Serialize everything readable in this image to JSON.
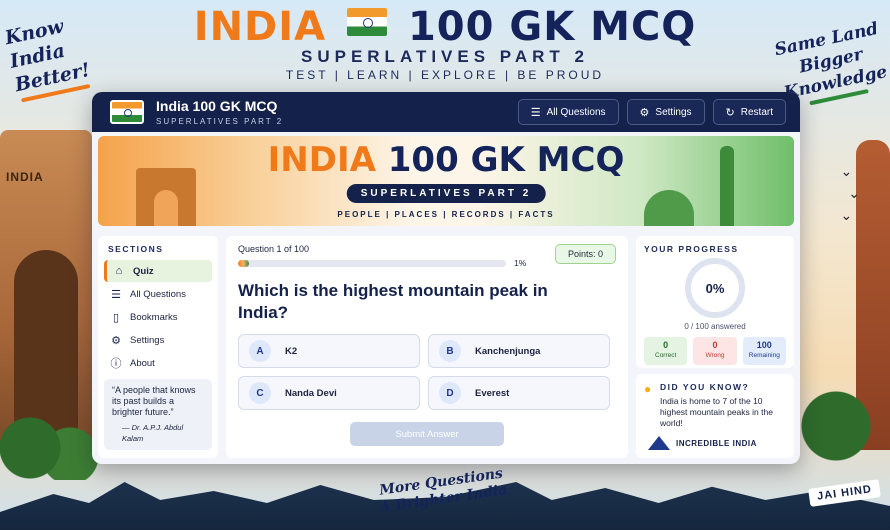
{
  "poster": {
    "title_india": "INDIA",
    "title_rest": "100 GK MCQ",
    "subtitle": "SUPERLATIVES PART 2",
    "tagline": "TEST | LEARN | EXPLORE | BE PROUD",
    "hand_left": [
      "Know",
      "India",
      "Better!"
    ],
    "hand_right": [
      "Same Land",
      "Bigger",
      "Knowledge"
    ],
    "bottom_left": [
      "More Questions",
      "A Brighter India"
    ],
    "jai_hind": "JAI HIND",
    "gate_label": "INDIA"
  },
  "app_bar": {
    "title": "India 100 GK MCQ",
    "subtitle": "SUPERLATIVES PART 2",
    "buttons": [
      {
        "label": "All Questions",
        "icon": "list-icon"
      },
      {
        "label": "Settings",
        "icon": "gear-icon"
      },
      {
        "label": "Restart",
        "icon": "restart-icon"
      }
    ]
  },
  "banner": {
    "title_india": "INDIA",
    "title_rest": "100 GK MCQ",
    "pill": "SUPERLATIVES PART 2",
    "tags": "PEOPLE | PLACES | RECORDS | FACTS"
  },
  "sidebar": {
    "heading": "SECTIONS",
    "items": [
      {
        "label": "Quiz",
        "icon": "home-icon",
        "active": true
      },
      {
        "label": "All Questions",
        "icon": "list-icon",
        "active": false
      },
      {
        "label": "Bookmarks",
        "icon": "bookmark-icon",
        "active": false
      },
      {
        "label": "Settings",
        "icon": "gear-icon",
        "active": false
      },
      {
        "label": "About",
        "icon": "info-icon",
        "active": false
      }
    ],
    "quote": "“A people that knows its past builds a brighter future.”",
    "quote_author": "— Dr. A.P.J. Abdul Kalam"
  },
  "quiz": {
    "counter": "Question 1 of 100",
    "progress_pct": 1,
    "progress_label": "1%",
    "points_label": "Points: 0",
    "question": "Which is the highest mountain peak in India?",
    "options": [
      {
        "letter": "A",
        "text": "K2"
      },
      {
        "letter": "B",
        "text": "Kanchenjunga"
      },
      {
        "letter": "C",
        "text": "Nanda Devi"
      },
      {
        "letter": "D",
        "text": "Everest"
      }
    ],
    "submit_label": "Submit Answer"
  },
  "progress_card": {
    "heading": "YOUR PROGRESS",
    "percent": "0%",
    "answered": "0 / 100 answered",
    "correct_value": "0",
    "correct_label": "Correct",
    "wrong_value": "0",
    "wrong_label": "Wrong",
    "remaining_value": "100",
    "remaining_label": "Remaining"
  },
  "did_you_know": {
    "heading": "DID YOU KNOW?",
    "text": "India is home to 7 of the 10 highest mountain peaks in the world!",
    "brand": "INCREDIBLE INDIA"
  },
  "colors": {
    "saffron": "#f07a1a",
    "navy": "#14214a",
    "green": "#2e8b3a"
  }
}
